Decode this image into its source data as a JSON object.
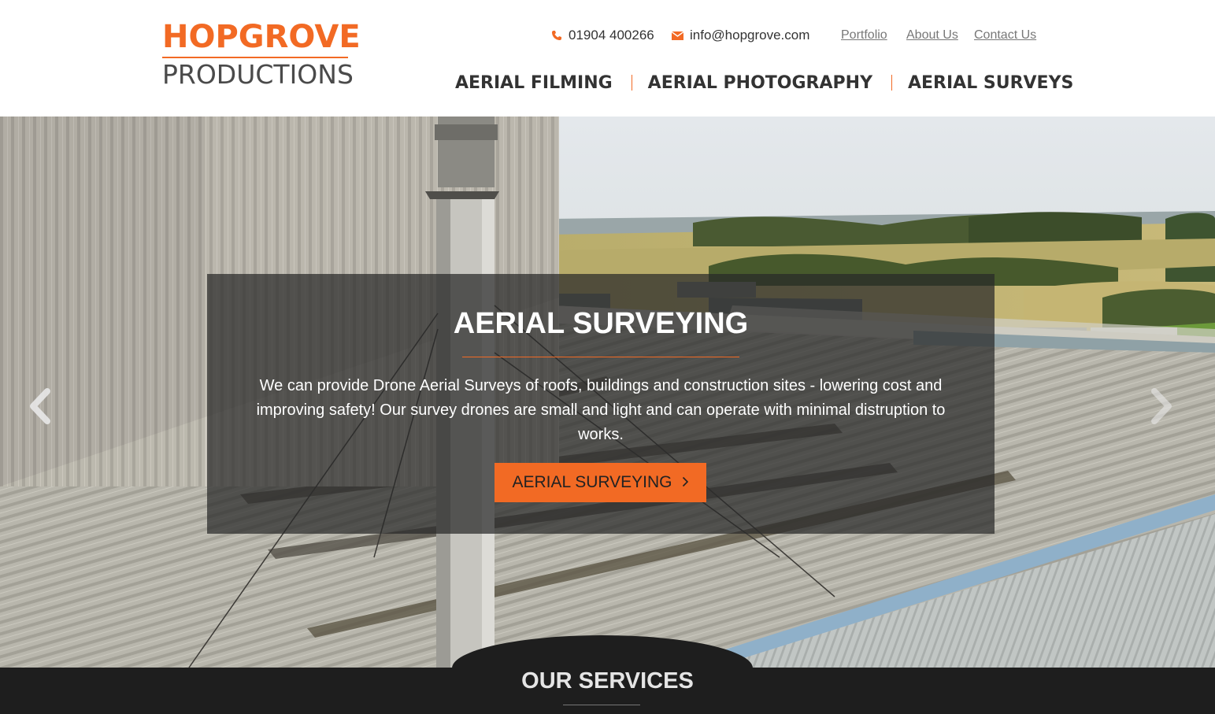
{
  "header": {
    "logo": {
      "line1": "HOPGROVE",
      "line2": "PRODUCTIONS"
    },
    "phone": {
      "icon": "phone-icon",
      "text": "01904 400266"
    },
    "email": {
      "icon": "mail-icon",
      "text": "info@hopgrove.com"
    },
    "top_links": [
      "Portfolio",
      "About Us",
      "Contact Us"
    ],
    "nav": [
      "AERIAL FILMING",
      "AERIAL PHOTOGRAPHY",
      "AERIAL SURVEYS"
    ]
  },
  "hero": {
    "title": "AERIAL SURVEYING",
    "text": "We can provide Drone Aerial Surveys of roofs, buildings and construction sites - lowering cost and improving safety! Our survey drones are small and light and can operate with minimal distruption to works.",
    "button_label": "AERIAL SURVEYING",
    "button_icon": "chevron-right-icon",
    "prev_icon": "chevron-left-icon",
    "next_icon": "chevron-right-icon"
  },
  "services": {
    "title": "OUR SERVICES"
  },
  "colors": {
    "accent": "#f26a24",
    "text": "#333333",
    "dark": "#1e1e1e"
  }
}
